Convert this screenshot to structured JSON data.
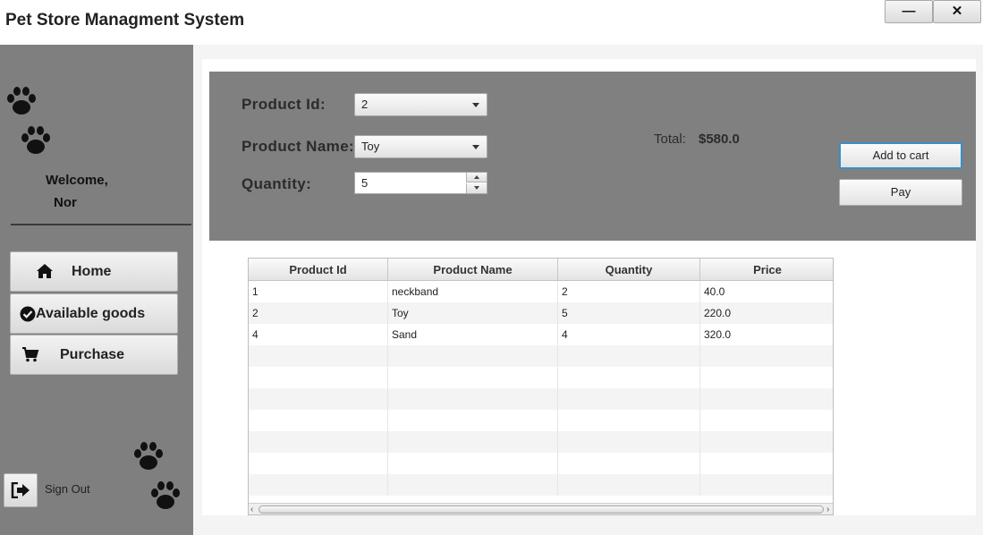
{
  "app": {
    "title": "Pet Store Managment System"
  },
  "window_controls": {
    "minimize": "—",
    "close": "✕"
  },
  "sidebar": {
    "welcome": "Welcome,",
    "username": "Nor",
    "nav": [
      {
        "label": "Home",
        "icon": "home-icon"
      },
      {
        "label": "Available goods",
        "icon": "check-circle-icon"
      },
      {
        "label": "Purchase",
        "icon": "cart-icon"
      }
    ],
    "sign_out": {
      "label": "Sign Out",
      "icon": "sign-out-icon"
    }
  },
  "form": {
    "product_id_label": "Product Id:",
    "product_id_value": "2",
    "product_name_label": "Product Name:",
    "product_name_value": "Toy",
    "quantity_label": "Quantity:",
    "quantity_value": "5",
    "total_label": "Total:",
    "total_value": "$580.0",
    "add_to_cart": "Add to cart",
    "pay": "Pay"
  },
  "table": {
    "columns": [
      "Product Id",
      "Product Name",
      "Quantity",
      "Price"
    ],
    "rows": [
      [
        "1",
        "neckband",
        "2",
        "40.0"
      ],
      [
        "2",
        "Toy",
        "5",
        "220.0"
      ],
      [
        "4",
        "Sand",
        "4",
        "320.0"
      ]
    ]
  },
  "colors": {
    "sidebar_bg": "#7f7f7f",
    "panel_bg": "#808080",
    "focus_border": "#3a8ec8"
  }
}
